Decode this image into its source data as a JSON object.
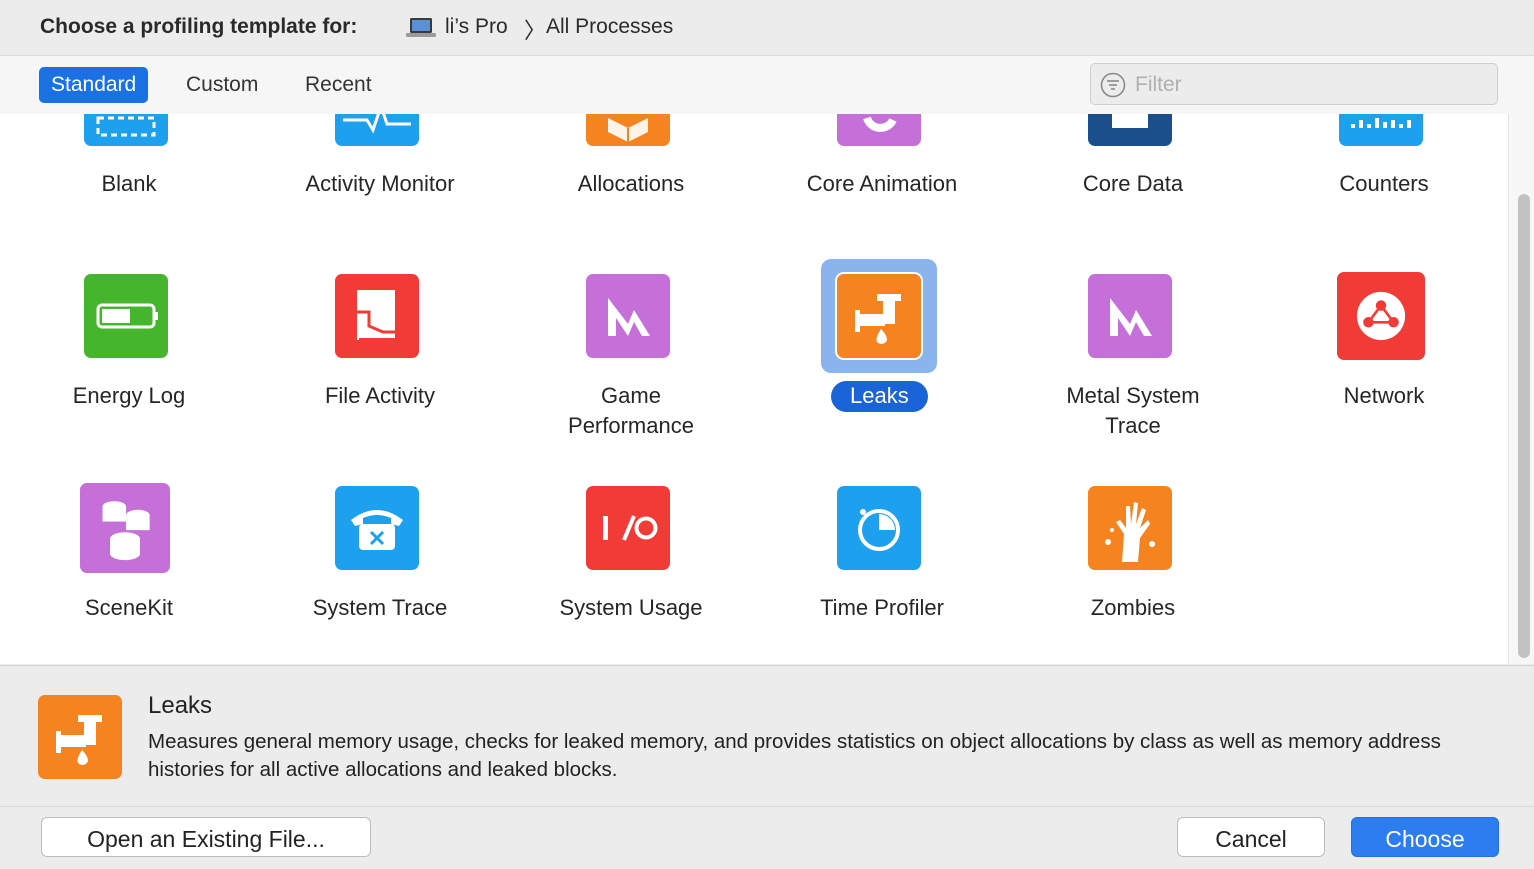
{
  "header": {
    "title": "Choose a profiling template for:",
    "device": "li’s Pro",
    "separator": "〉",
    "process": "All Processes"
  },
  "tabs": [
    {
      "label": "Standard",
      "active": true
    },
    {
      "label": "Custom",
      "active": false
    },
    {
      "label": "Recent",
      "active": false
    }
  ],
  "filter": {
    "placeholder": "Filter",
    "value": ""
  },
  "templates": [
    {
      "name": "Blank",
      "icon": "blank-icon"
    },
    {
      "name": "Activity Monitor",
      "icon": "activity-monitor-icon"
    },
    {
      "name": "Allocations",
      "icon": "allocations-icon"
    },
    {
      "name": "Core Animation",
      "icon": "core-animation-icon"
    },
    {
      "name": "Core Data",
      "icon": "core-data-icon"
    },
    {
      "name": "Counters",
      "icon": "counters-icon"
    },
    {
      "name": "Energy Log",
      "icon": "battery-icon"
    },
    {
      "name": "File Activity",
      "icon": "file-activity-icon"
    },
    {
      "name": "Game Performance",
      "icon": "metal-icon"
    },
    {
      "name": "Leaks",
      "icon": "leaks-faucet-icon",
      "selected": true
    },
    {
      "name": "Metal System Trace",
      "icon": "metal-icon"
    },
    {
      "name": "Network",
      "icon": "network-globe-icon"
    },
    {
      "name": "SceneKit",
      "icon": "scenekit-icon"
    },
    {
      "name": "System Trace",
      "icon": "telephone-icon"
    },
    {
      "name": "System Usage",
      "icon": "io-icon"
    },
    {
      "name": "Time Profiler",
      "icon": "stopwatch-icon"
    },
    {
      "name": "Zombies",
      "icon": "zombie-hand-icon"
    }
  ],
  "labels": {
    "game_performance": [
      "Game",
      "Performance"
    ],
    "metal_system_trace": [
      "Metal System",
      "Trace"
    ]
  },
  "description": {
    "name": "Leaks",
    "text": "Measures general memory usage, checks for leaked memory, and provides statistics on object allocations by class as well as memory address histories for all active allocations and leaked blocks."
  },
  "buttons": {
    "open_existing": "Open an Existing File...",
    "cancel": "Cancel",
    "choose": "Choose"
  },
  "colors": {
    "accent": "#1a71e4",
    "blue_icon": "#1da1ef",
    "orange_icon": "#f5831f",
    "purple_icon": "#c56fd8",
    "red_icon": "#f03b36",
    "green_icon": "#45b52d",
    "navy_icon": "#1b4f8c"
  }
}
